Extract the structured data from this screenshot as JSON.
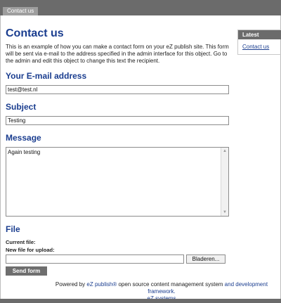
{
  "topbar": {
    "tab_label": "Contact us"
  },
  "main": {
    "title": "Contact us",
    "intro": "This is an example of how you can make a contact form on your eZ publish site. This form will be sent via e-mail to the address specified in the admin interface for this object. Go to the admin and edit this object to change this text the recipient.",
    "email_heading": "Your E-mail address",
    "email_value": "test@test.nl",
    "subject_heading": "Subject",
    "subject_value": "Testing",
    "message_heading": "Message",
    "message_value": "Again testing",
    "file_heading": "File",
    "current_file_label": "Current file:",
    "new_file_label": "New file for upload:",
    "browse_label": "Bladeren...",
    "send_label": "Send form"
  },
  "sidebar": {
    "heading": "Latest",
    "link": "Contact us"
  },
  "footer": {
    "powered_by": "Powered by",
    "ez_publish_link": "eZ publish®",
    "oss_text": "open source content management system",
    "and_text": "and development framework.",
    "ez_systems_link": "eZ systems"
  }
}
